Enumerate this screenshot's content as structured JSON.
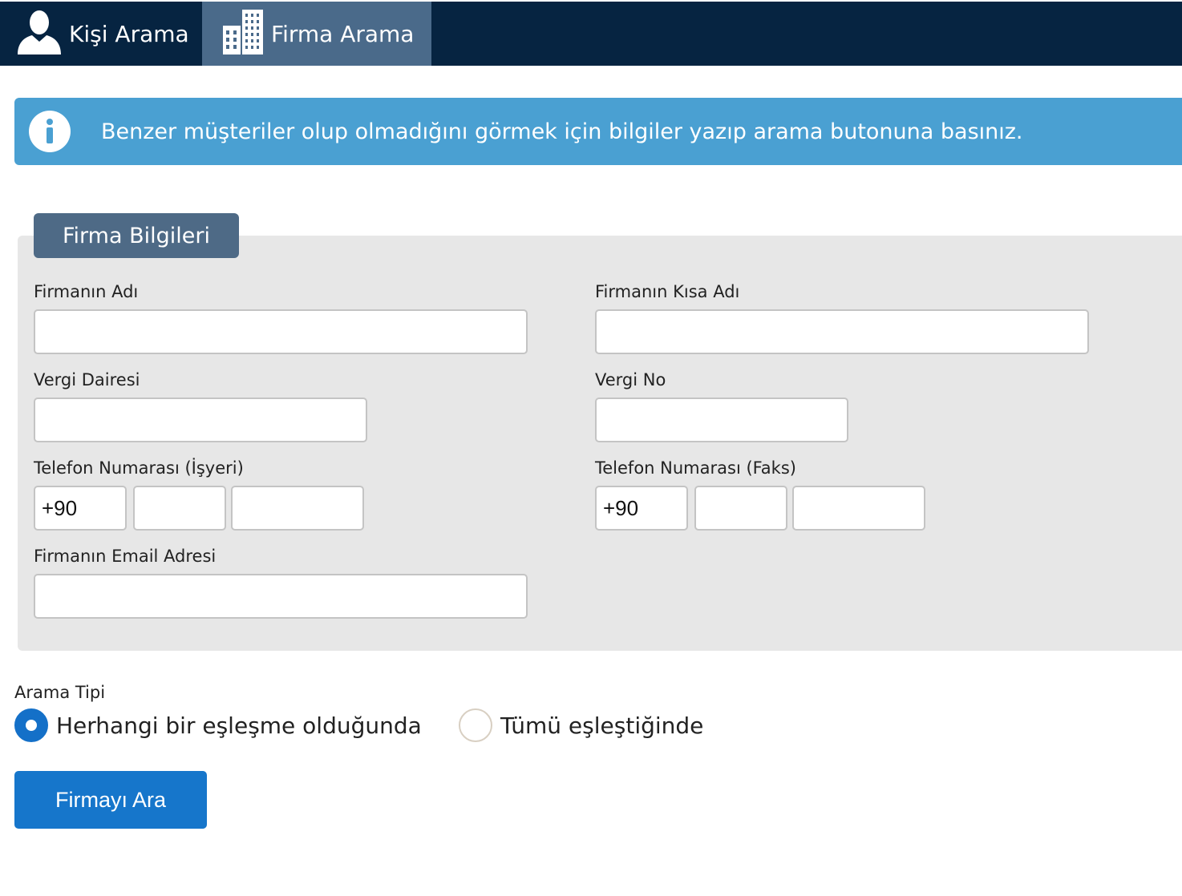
{
  "tabs": [
    {
      "label": "Kişi Arama",
      "icon": "person-icon",
      "active": false
    },
    {
      "label": "Firma Arama",
      "icon": "building-icon",
      "active": true
    }
  ],
  "info": {
    "icon": "info-icon",
    "text": "Benzer müşteriler olup olmadığını görmek için bilgiler yazıp arama butonuna basınız."
  },
  "form": {
    "legend": "Firma Bilgileri",
    "company_name_label": "Firmanın Adı",
    "company_name_value": "",
    "short_name_label": "Firmanın Kısa Adı",
    "short_name_value": "",
    "tax_office_label": "Vergi Dairesi",
    "tax_office_value": "",
    "tax_no_label": "Vergi No",
    "tax_no_value": "",
    "phone_label": "Telefon Numarası (İşyeri)",
    "phone_country": "+90",
    "phone_area": "",
    "phone_number": "",
    "fax_label": "Telefon Numarası (Faks)",
    "fax_country": "+90",
    "fax_area": "",
    "fax_number": "",
    "email_label": "Firmanın Email Adresi",
    "email_value": ""
  },
  "search_type": {
    "label": "Arama Tipi",
    "options": [
      {
        "label": "Herhangi bir eşleşme olduğunda",
        "checked": true
      },
      {
        "label": "Tümü eşleştiğinde",
        "checked": false
      }
    ]
  },
  "search_button": "Firmayı Ara",
  "colors": {
    "topbar": "#062441",
    "active_tab": "#4a6a8a",
    "info_banner": "#4aa0d2",
    "legend": "#4e6a86",
    "primary_button": "#1676cb"
  }
}
